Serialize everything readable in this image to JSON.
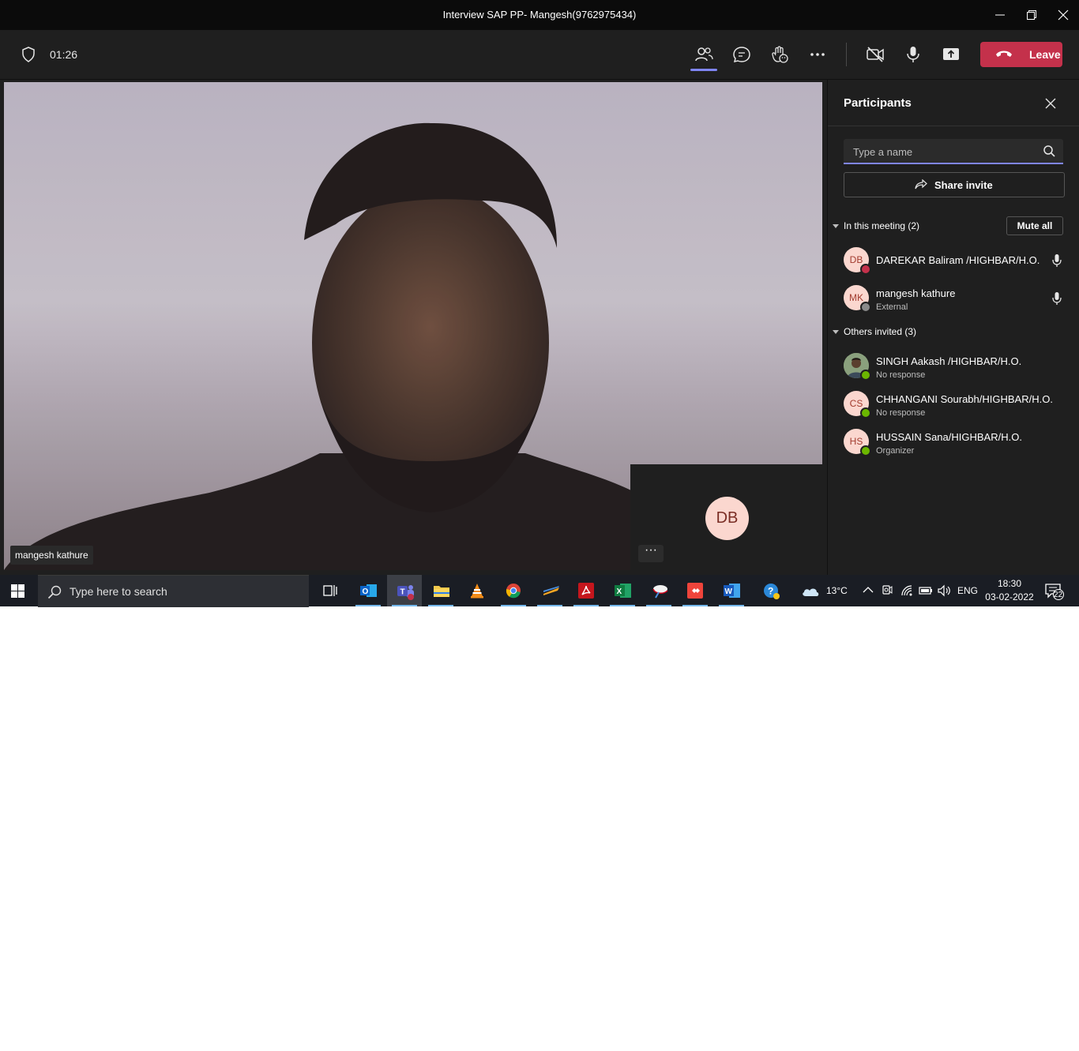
{
  "window": {
    "title": "Interview SAP PP- Mangesh(9762975434)"
  },
  "toolbar": {
    "timer": "01:26",
    "leave_label": "Leave",
    "icons": [
      "people-icon",
      "chat-icon",
      "reactions-icon",
      "more-icon",
      "camera-off-icon",
      "mic-icon",
      "share-screen-icon"
    ]
  },
  "video": {
    "main_participant": "mangesh kathure",
    "self_initials": "DB",
    "self_more": "···"
  },
  "panel": {
    "title": "Participants",
    "search_placeholder": "Type a name",
    "share_invite": "Share invite",
    "in_meeting_label": "In this meeting (2)",
    "mute_all": "Mute all",
    "others_label": "Others invited (3)",
    "in_meeting": [
      {
        "initials": "DB",
        "name": "DAREKAR Baliram /HIGHBAR/H.O.",
        "sub": "",
        "status_color": "#c4314b"
      },
      {
        "initials": "MK",
        "name": "mangesh kathure",
        "sub": "External",
        "status_color": "#8a8a8a"
      }
    ],
    "others": [
      {
        "initials": "",
        "name": "SINGH Aakash /HIGHBAR/H.O.",
        "sub": "No response",
        "status_color": "#6bb700"
      },
      {
        "initials": "CS",
        "name": "CHHANGANI Sourabh/HIGHBAR/H.O.",
        "sub": "No response",
        "status_color": "#6bb700"
      },
      {
        "initials": "HS",
        "name": "HUSSAIN Sana/HIGHBAR/H.O.",
        "sub": "Organizer",
        "status_color": "#6bb700"
      }
    ]
  },
  "taskbar": {
    "search_placeholder": "Type here to search",
    "weather": "13°C",
    "language": "ENG",
    "time": "18:30",
    "date": "03-02-2022",
    "notifications": "22",
    "accent": "#76b9ed"
  }
}
